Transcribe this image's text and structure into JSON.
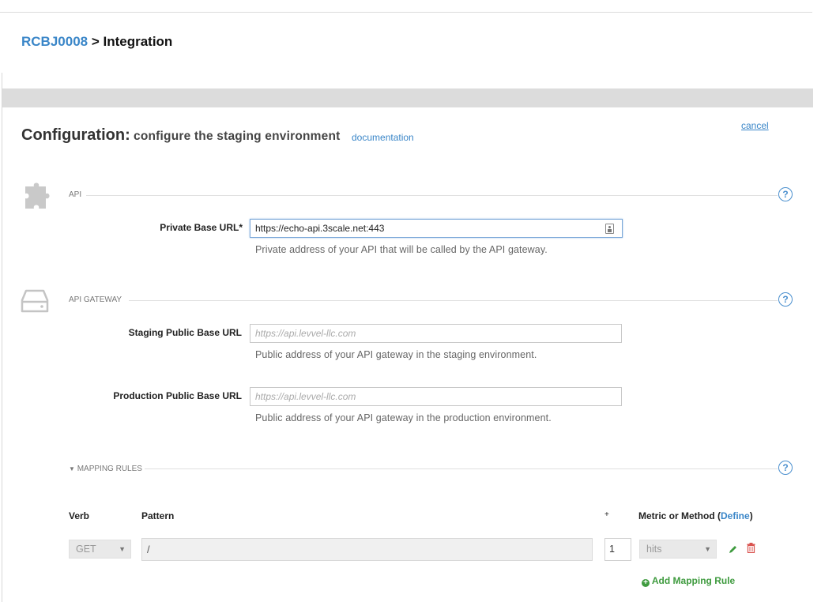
{
  "breadcrumb": {
    "link": "RCBJ0008",
    "separator": " > ",
    "current": "Integration"
  },
  "config": {
    "title": "Configuration:",
    "subtitle": "configure the staging environment",
    "doc_link": "documentation",
    "cancel": "cancel"
  },
  "api_section": {
    "label": "API",
    "help": "?",
    "private_url": {
      "label": "Private Base URL*",
      "value": "https://echo-api.3scale.net:443",
      "hint": "Private address of your API that will be called by the API gateway."
    }
  },
  "gateway_section": {
    "label": "API GATEWAY",
    "help": "?",
    "staging_url": {
      "label": "Staging Public Base URL",
      "placeholder": "https://api.levvel-llc.com",
      "hint": "Public address of your API gateway in the staging environment."
    },
    "production_url": {
      "label": "Production Public Base URL",
      "placeholder": "https://api.levvel-llc.com",
      "hint": "Public address of your API gateway in the production environment."
    }
  },
  "mapping": {
    "label": "MAPPING RULES",
    "help": "?",
    "headers": {
      "verb": "Verb",
      "pattern": "Pattern",
      "plus": "+",
      "metric": "Metric or Method (",
      "define": "Define",
      "close": ")"
    },
    "rows": [
      {
        "verb": "GET",
        "pattern": "/",
        "increment": "1",
        "metric": "hits"
      }
    ],
    "add_rule": "Add Mapping Rule"
  },
  "colors": {
    "link": "#3a86c8",
    "help": "#4a8fce",
    "add": "#3f9b3f",
    "delete": "#d9534f"
  }
}
